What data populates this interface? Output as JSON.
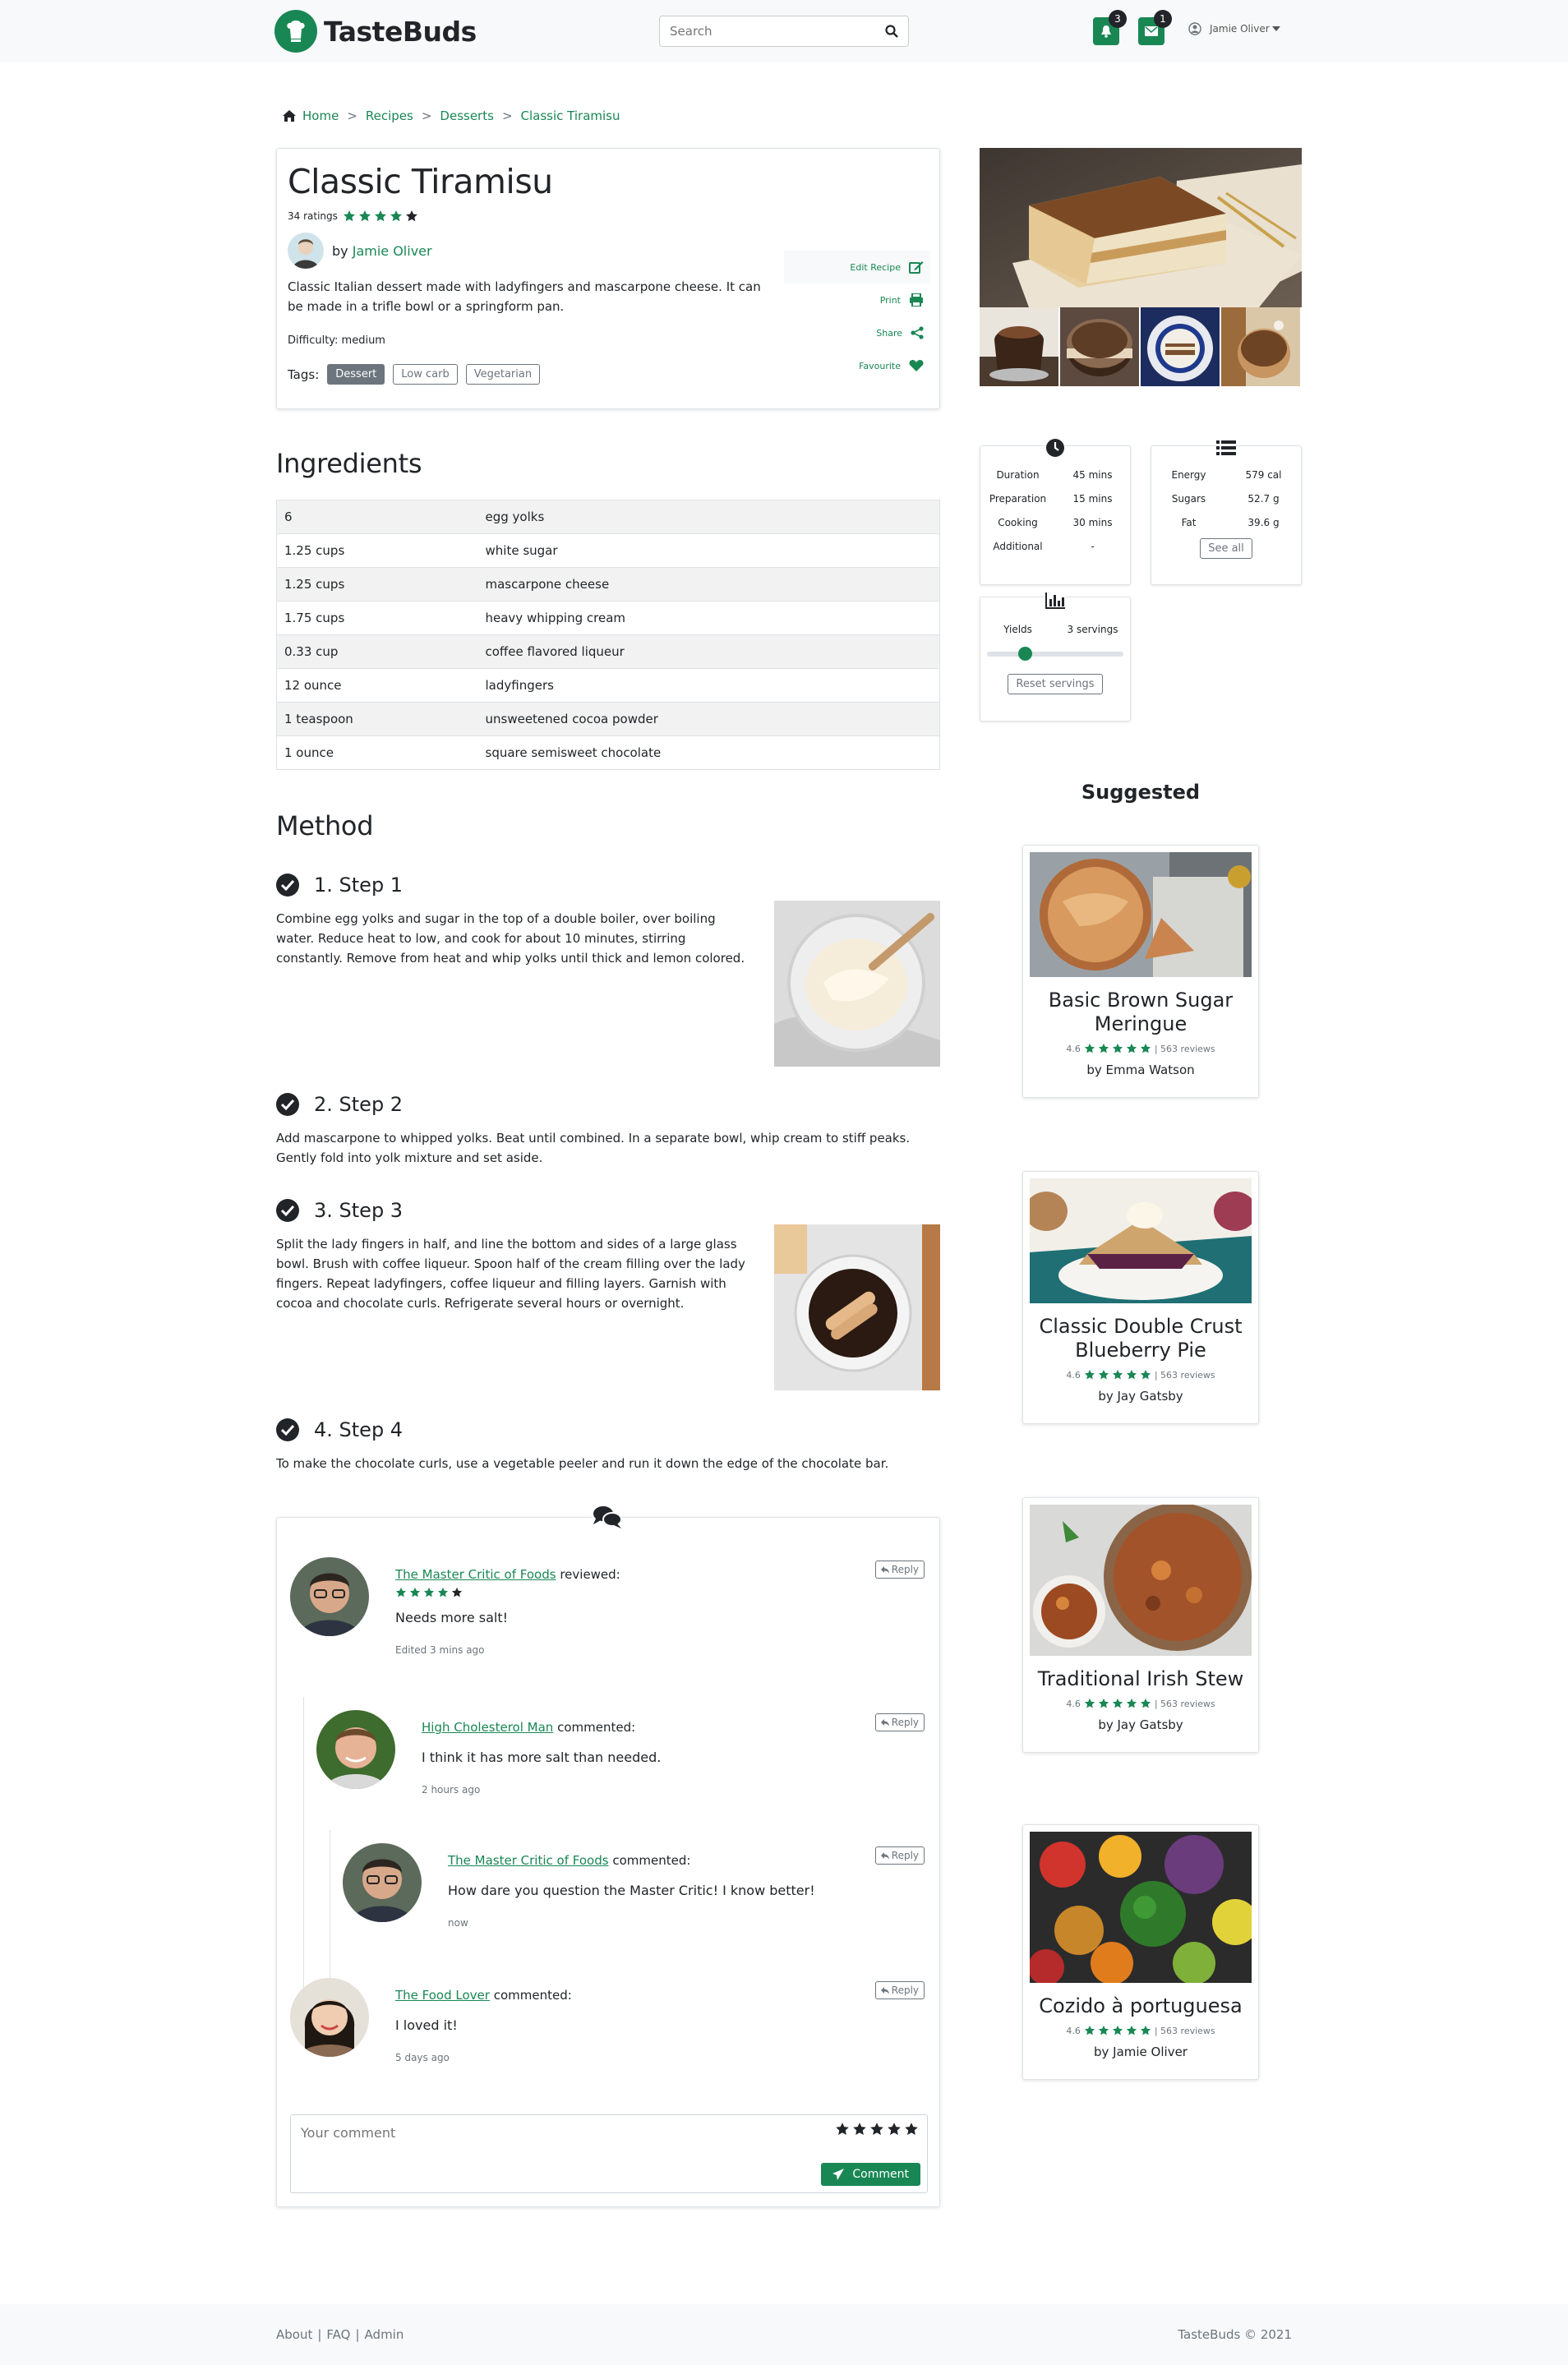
{
  "brand": {
    "name": "TasteBuds",
    "accent": "#198754"
  },
  "navbar": {
    "search_placeholder": "Search",
    "notifications_count": "3",
    "messages_count": "1",
    "user_name": "Jamie Oliver"
  },
  "breadcrumb": [
    "Home",
    "Recipes",
    "Desserts",
    "Classic Tiramisu"
  ],
  "recipe": {
    "title": "Classic Tiramisu",
    "ratings_text": "34 ratings",
    "rating": 4,
    "author_prefix": "by",
    "author": "Jamie Oliver",
    "description": "Classic Italian dessert made with ladyfingers and mascarpone cheese. It can be made in a trifle bowl or a springform pan.",
    "difficulty": "Difficulty: medium",
    "tags_label": "Tags:",
    "tags": [
      {
        "label": "Dessert",
        "selected": true
      },
      {
        "label": "Low carb",
        "selected": false
      },
      {
        "label": "Vegetarian",
        "selected": false
      }
    ],
    "actions": [
      {
        "label": "Edit Recipe",
        "icon": "edit-icon"
      },
      {
        "label": "Print",
        "icon": "print-icon"
      },
      {
        "label": "Share",
        "icon": "share-icon"
      },
      {
        "label": "Favourite",
        "icon": "heart-icon"
      }
    ]
  },
  "times": {
    "icon": "clock-icon",
    "rows": [
      [
        "Duration",
        "45 mins"
      ],
      [
        "Preparation",
        "15 mins"
      ],
      [
        "Cooking",
        "30 mins"
      ],
      [
        "Additional",
        "-"
      ]
    ]
  },
  "nutrition": {
    "icon": "list-icon",
    "rows": [
      [
        "Energy",
        "579 cal"
      ],
      [
        "Sugars",
        "52.7 g"
      ],
      [
        "Fat",
        "39.6 g"
      ]
    ],
    "button": "See all"
  },
  "yields": {
    "icon": "chart-icon",
    "label": "Yields",
    "value": "3 servings",
    "slider_fraction": 0.25,
    "button": "Reset servings"
  },
  "ingredients": {
    "heading": "Ingredients",
    "items": [
      [
        "6",
        "egg yolks"
      ],
      [
        "1.25 cups",
        "white sugar"
      ],
      [
        "1.25 cups",
        "mascarpone cheese"
      ],
      [
        "1.75 cups",
        "heavy whipping cream"
      ],
      [
        "0.33 cup",
        "coffee flavored liqueur"
      ],
      [
        "12 ounce",
        "ladyfingers"
      ],
      [
        "1 teaspoon",
        "unsweetened cocoa powder"
      ],
      [
        "1 ounce",
        "square semisweet chocolate"
      ]
    ]
  },
  "method": {
    "heading": "Method",
    "steps": [
      {
        "title": "1. Step 1",
        "text": "Combine egg yolks and sugar in the top of a double boiler, over boiling water. Reduce heat to low, and cook for about 10 minutes, stirring constantly. Remove from heat and whip yolks until thick and lemon colored."
      },
      {
        "title": "2. Step 2",
        "text": "Add mascarpone to whipped yolks. Beat until combined. In a separate bowl, whip cream to stiff peaks. Gently fold into yolk mixture and set aside."
      },
      {
        "title": "3. Step 3",
        "text": "Split the lady fingers in half, and line the bottom and sides of a large glass bowl. Brush with coffee liqueur. Spoon half of the cream filling over the lady fingers. Repeat ladyfingers, coffee liqueur and filling layers. Garnish with cocoa and chocolate curls. Refrigerate several hours or overnight."
      },
      {
        "title": "4. Step 4",
        "text": "To make the chocolate curls, use a vegetable peeler and run it down the edge of the chocolate bar."
      }
    ]
  },
  "comments": {
    "items": [
      {
        "author": "The Master Critic of Foods",
        "action": "reviewed:",
        "rating": 4,
        "text": "Needs more salt!",
        "time": "Edited 3 mins ago",
        "reply": "Reply"
      },
      {
        "author": "High Cholesterol Man",
        "action": "commented:",
        "text": "I think it has more salt than needed.",
        "time": "2 hours ago",
        "reply": "Reply"
      },
      {
        "author": "The Master Critic of Foods",
        "action": "commented:",
        "text": "How dare you question the Master Critic! I know better!",
        "time": "now",
        "reply": "Reply"
      },
      {
        "author": "The Food Lover",
        "action": "commented:",
        "text": "I loved it!",
        "time": "5 days ago",
        "reply": "Reply"
      }
    ],
    "form": {
      "placeholder": "Your comment",
      "button": "Comment"
    }
  },
  "suggested": {
    "heading": "Suggested",
    "items": [
      {
        "title": "Basic Brown Sugar Meringue",
        "rating": "4.6",
        "reviews": "| 563 reviews",
        "author": "by Emma Watson"
      },
      {
        "title": "Classic Double Crust Blueberry Pie",
        "rating": "4.6",
        "reviews": "| 563 reviews",
        "author": "by Jay Gatsby"
      },
      {
        "title": "Traditional Irish Stew",
        "rating": "4.6",
        "reviews": "| 563 reviews",
        "author": "by Jay Gatsby"
      },
      {
        "title": "Cozido à portuguesa",
        "rating": "4.6",
        "reviews": "| 563 reviews",
        "author": "by Jamie Oliver"
      }
    ]
  },
  "footer": {
    "links": [
      "About",
      "FAQ",
      "Admin"
    ],
    "sep": "|",
    "copyright": "TasteBuds © 2021"
  }
}
